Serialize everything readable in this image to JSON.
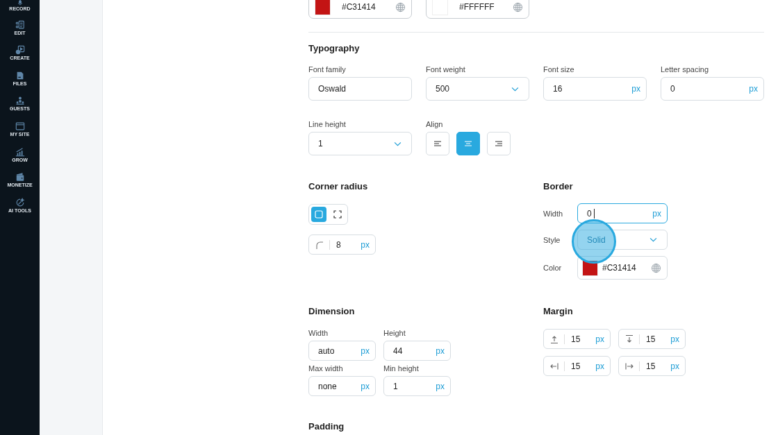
{
  "sidebar": {
    "items": [
      {
        "label": "RECORD",
        "kind": "microphone"
      },
      {
        "label": "EDIT",
        "kind": "document"
      },
      {
        "label": "CREATE",
        "kind": "play"
      },
      {
        "label": "FILES",
        "kind": "folder"
      },
      {
        "label": "GUESTS",
        "kind": "people"
      },
      {
        "label": "MY SITE",
        "kind": "browser"
      },
      {
        "label": "GROW",
        "kind": "chart"
      },
      {
        "label": "MONETIZE",
        "kind": "wallet"
      },
      {
        "label": "AI TOOLS",
        "kind": "sparkle"
      }
    ]
  },
  "colors": [
    {
      "value": "#C31414",
      "color": "#c31414"
    },
    {
      "value": "#FFFFFF",
      "color": "#ffffff"
    }
  ],
  "typography": {
    "title": "Typography",
    "fields": [
      {
        "label": "Font family",
        "value": "Oswald",
        "kind": "text"
      },
      {
        "label": "Font weight",
        "value": "500",
        "kind": "select"
      },
      {
        "label": "Font size",
        "value": "16",
        "unit": "px",
        "kind": "unit"
      },
      {
        "label": "Letter spacing",
        "value": "0",
        "unit": "px",
        "kind": "unit"
      },
      {
        "label": "Line height",
        "value": "1",
        "kind": "select"
      }
    ],
    "align": {
      "label": "Align",
      "options": [
        {
          "kind": "left",
          "selected": false
        },
        {
          "kind": "center",
          "selected": true
        },
        {
          "kind": "right",
          "selected": false
        }
      ]
    }
  },
  "corner_radius": {
    "title": "Corner radius",
    "modes": [
      {
        "kind": "uniform",
        "selected": true
      },
      {
        "kind": "individual",
        "selected": false
      }
    ],
    "value": "8",
    "unit": "px"
  },
  "border": {
    "title": "Border",
    "width": {
      "label": "Width",
      "value": "0",
      "unit": "px",
      "focused": true
    },
    "style": {
      "label": "Style",
      "value": "Solid",
      "clicked": true
    },
    "color": {
      "label": "Color",
      "value": "#C31414",
      "color": "#c31414"
    }
  },
  "dimension": {
    "title": "Dimension",
    "fields": [
      {
        "label": "Width",
        "value": "auto",
        "unit": "px"
      },
      {
        "label": "Height",
        "value": "44",
        "unit": "px"
      },
      {
        "label": "Max width",
        "value": "none",
        "unit": "px"
      },
      {
        "label": "Min height",
        "value": "1",
        "unit": "px"
      }
    ]
  },
  "margin": {
    "title": "Margin",
    "fields": [
      {
        "kind": "top",
        "value": "15",
        "unit": "px"
      },
      {
        "kind": "bottom",
        "value": "15",
        "unit": "px"
      },
      {
        "kind": "left",
        "value": "15",
        "unit": "px"
      },
      {
        "kind": "right",
        "value": "15",
        "unit": "px"
      }
    ]
  },
  "padding": {
    "title": "Padding"
  }
}
